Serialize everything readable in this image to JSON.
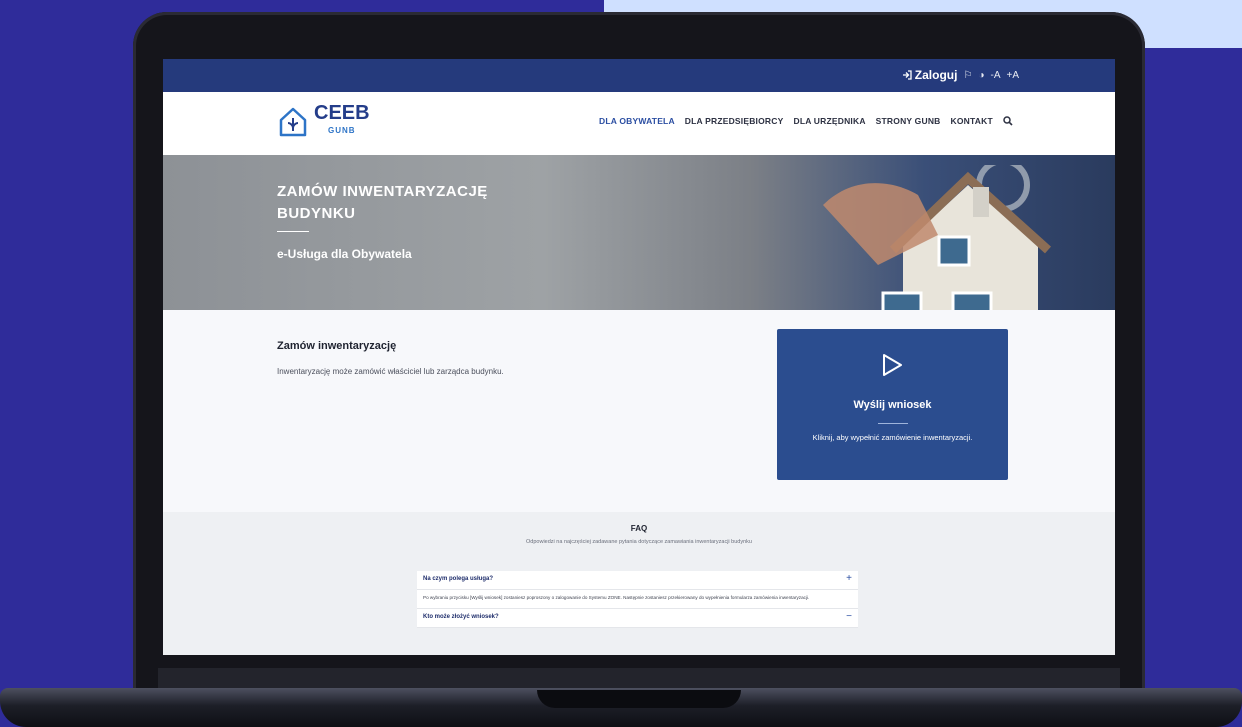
{
  "topbar": {
    "login_label": "Zaloguj",
    "tools": [
      "⚐",
      "◑",
      "-A",
      "+A"
    ]
  },
  "logo": {
    "name": "CEEB",
    "sub": "GUNB"
  },
  "nav": {
    "items": [
      {
        "label": "DLA OBYWATELA",
        "active": true
      },
      {
        "label": "DLA PRZEDSIĘBIORCY",
        "active": false
      },
      {
        "label": "DLA URZĘDNIKA",
        "active": false
      },
      {
        "label": "STRONY GUNB",
        "active": false
      },
      {
        "label": "KONTAKT",
        "active": false
      }
    ]
  },
  "hero": {
    "title": "ZAMÓW INWENTARYZACJĘ BUDYNKU",
    "subtitle": "e-Usługa dla Obywatela"
  },
  "intro": {
    "title": "Zamów inwentaryzację",
    "text": "Inwentaryzację może zamówić właściciel lub zarządca budynku."
  },
  "cta": {
    "title": "Wyślij wniosek",
    "text": "Kliknij, aby wypełnić zamówienie inwentaryzacji."
  },
  "faq": {
    "title": "FAQ",
    "subtitle": "Odpowiedzi na najczęściej zadawane pytania dotyczące zamawiania inwentaryzacji budynku",
    "items": [
      {
        "question": "Na czym polega usługa?",
        "toggle": "+",
        "answer": "Po wybraniu przycisku [Wyślij wniosek] zostaniesz poproszony o zalogowanie do Systemu ZONE. Następnie zostaniesz przekierowany do wypełnienia formularza zamówienia inwentaryzacji."
      },
      {
        "question": "Kto może złożyć wniosek?",
        "toggle": "−",
        "answer": ""
      }
    ]
  },
  "colors": {
    "background": "#2f2c9a",
    "topbar": "#253a7c",
    "cta": "#2b4d8f",
    "accent": "#2b4ea2"
  }
}
